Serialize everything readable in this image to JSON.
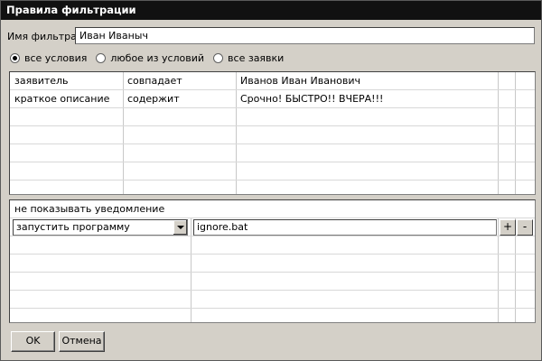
{
  "window": {
    "title": "Правила фильтрации"
  },
  "filter_name": {
    "label": "Имя фильтра:",
    "value": "Иван Иваныч"
  },
  "match_mode": {
    "options": [
      {
        "label": "все условия",
        "selected": true
      },
      {
        "label": "любое из условий",
        "selected": false
      },
      {
        "label": "все заявки",
        "selected": false
      }
    ]
  },
  "conditions": {
    "rows": [
      {
        "field": "заявитель",
        "operator": "совпадает",
        "value": "Иванов Иван Иванович"
      },
      {
        "field": "краткое описание",
        "operator": "содержит",
        "value": "Срочно! БЫСТРО!! ВЧЕРА!!!"
      }
    ]
  },
  "actions": {
    "header": "не показывать уведомление",
    "edit_row": {
      "action": "запустить программу",
      "argument": "ignore.bat"
    },
    "add_label": "+",
    "remove_label": "-"
  },
  "buttons": {
    "ok": "OK",
    "cancel": "Отмена"
  },
  "colors": {
    "titlebar": "#111111",
    "window_bg": "#d4d0c8",
    "grid_bg": "#ffffff"
  }
}
